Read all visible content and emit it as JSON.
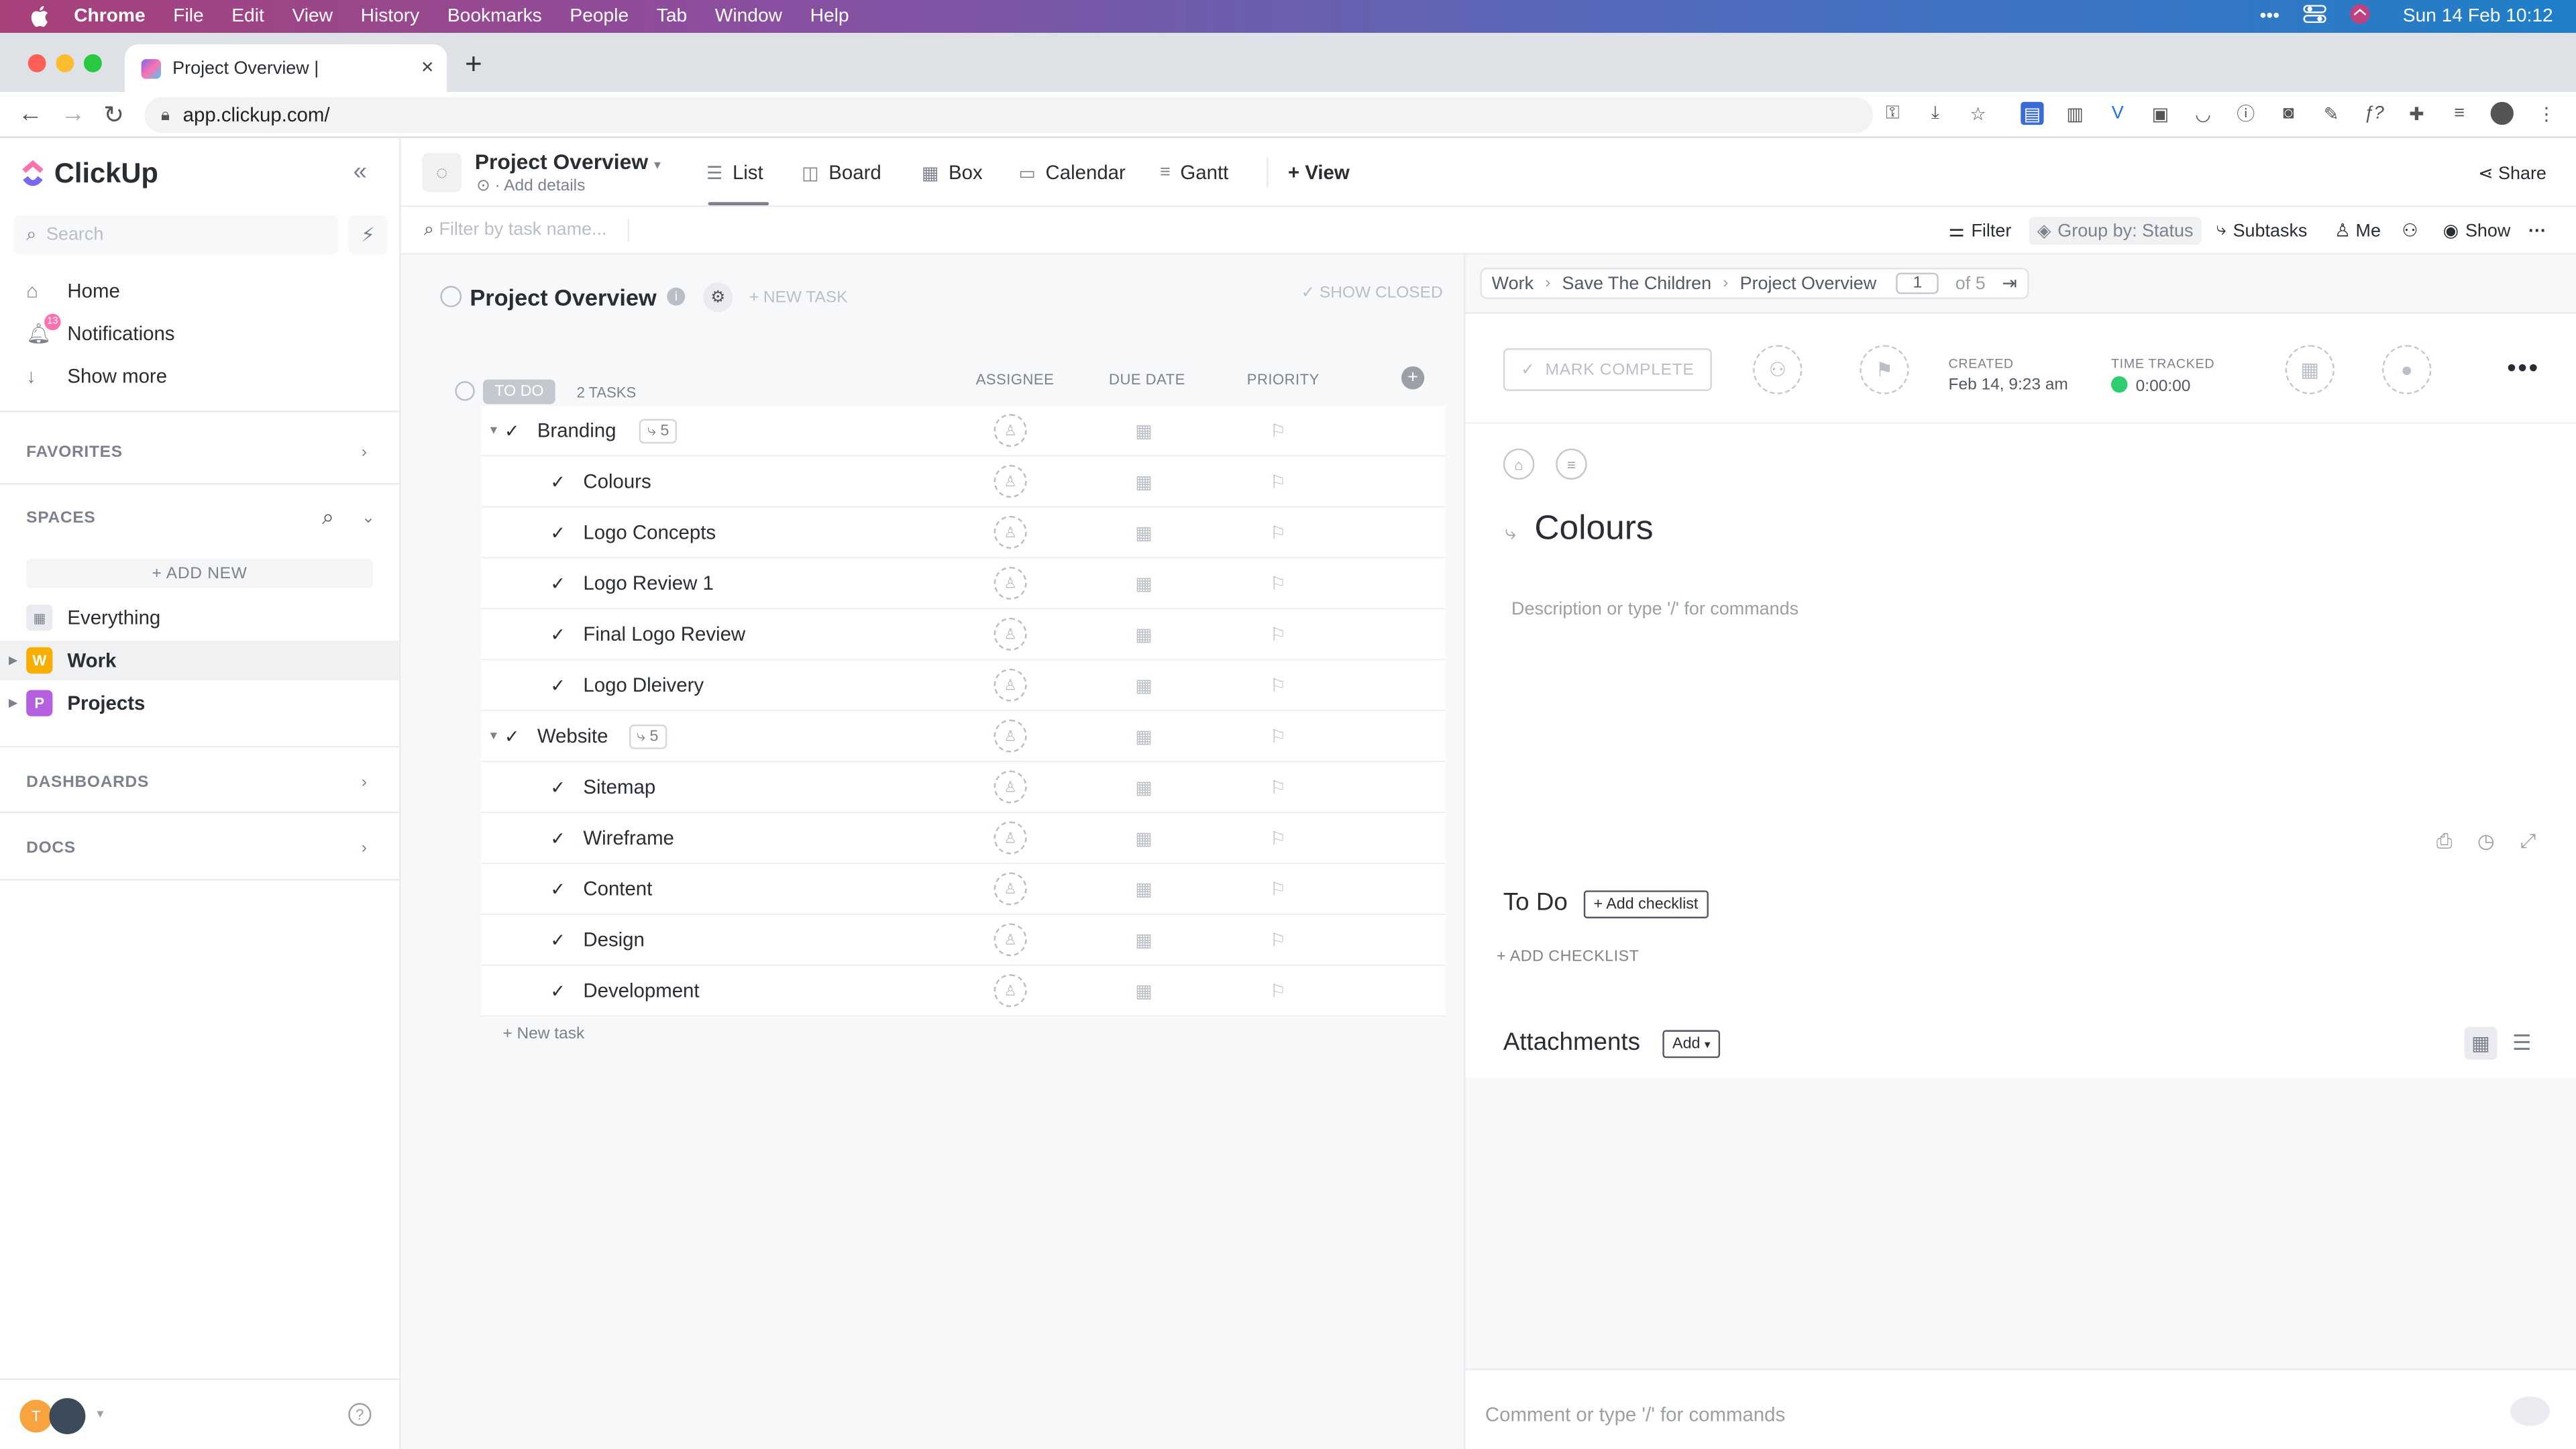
{
  "menubar": {
    "app": "Chrome",
    "items": [
      "File",
      "Edit",
      "View",
      "History",
      "Bookmarks",
      "People",
      "Tab",
      "Window",
      "Help"
    ],
    "clock": "Sun 14 Feb  10:12"
  },
  "browser": {
    "tab_title": "Project Overview |",
    "url": "app.clickup.com/"
  },
  "sidebar": {
    "logo": "ClickUp",
    "search_placeholder": "Search",
    "nav": [
      {
        "label": "Home",
        "icon": "home-icon"
      },
      {
        "label": "Notifications",
        "icon": "bell-icon",
        "badge": "13"
      },
      {
        "label": "Show more",
        "icon": "arrow-down-icon"
      }
    ],
    "favorites": "FAVORITES",
    "spaces": "SPACES",
    "add_new": "+ ADD NEW",
    "space_items": [
      {
        "label": "Everything",
        "avatar": ""
      },
      {
        "label": "Work",
        "avatar": "W",
        "color": "#f8ae00"
      },
      {
        "label": "Projects",
        "avatar": "P",
        "color": "#b660e0"
      }
    ],
    "dashboards": "DASHBOARDS",
    "docs": "DOCS",
    "user_initial": "T"
  },
  "header": {
    "title": "Project Overview",
    "subtitle": "Add details",
    "views": [
      "List",
      "Board",
      "Box",
      "Calendar",
      "Gantt"
    ],
    "add_view": "+ View",
    "share": "Share"
  },
  "filterbar": {
    "placeholder": "Filter by task name...",
    "filter": "Filter",
    "group_by": "Group by: Status",
    "subtasks": "Subtasks",
    "me": "Me",
    "show": "Show"
  },
  "list": {
    "title": "Project Overview",
    "new_task": "+ NEW TASK",
    "show_closed": "SHOW CLOSED",
    "status": "TO DO",
    "task_count": "2 TASKS",
    "columns": {
      "assignee": "ASSIGNEE",
      "due": "DUE DATE",
      "priority": "PRIORITY"
    },
    "tasks": [
      {
        "name": "Branding",
        "subtasks": "5",
        "parent": true
      },
      {
        "name": "Colours"
      },
      {
        "name": "Logo Concepts"
      },
      {
        "name": "Logo Review 1"
      },
      {
        "name": "Final Logo Review"
      },
      {
        "name": "Logo Dleivery"
      },
      {
        "name": "Website",
        "subtasks": "5",
        "parent": true
      },
      {
        "name": "Sitemap"
      },
      {
        "name": "Wireframe"
      },
      {
        "name": "Content"
      },
      {
        "name": "Design"
      },
      {
        "name": "Development"
      }
    ],
    "add_task": "+ New task"
  },
  "detail": {
    "breadcrumb": [
      "Work",
      "Save The Children",
      "Project Overview"
    ],
    "page": "1",
    "of": "of 5",
    "mark_complete": "MARK COMPLETE",
    "created_label": "CREATED",
    "created_value": "Feb 14, 9:23 am",
    "time_label": "TIME TRACKED",
    "time_value": "0:00:00",
    "title": "Colours",
    "description_placeholder": "Description or type '/' for commands",
    "checklist_heading": "To Do",
    "add_checklist_btn": "+ Add checklist",
    "add_checklist_link": "+ ADD CHECKLIST",
    "attachments": "Attachments",
    "attach_add": "Add",
    "comment_placeholder": "Comment or type '/' for commands"
  }
}
